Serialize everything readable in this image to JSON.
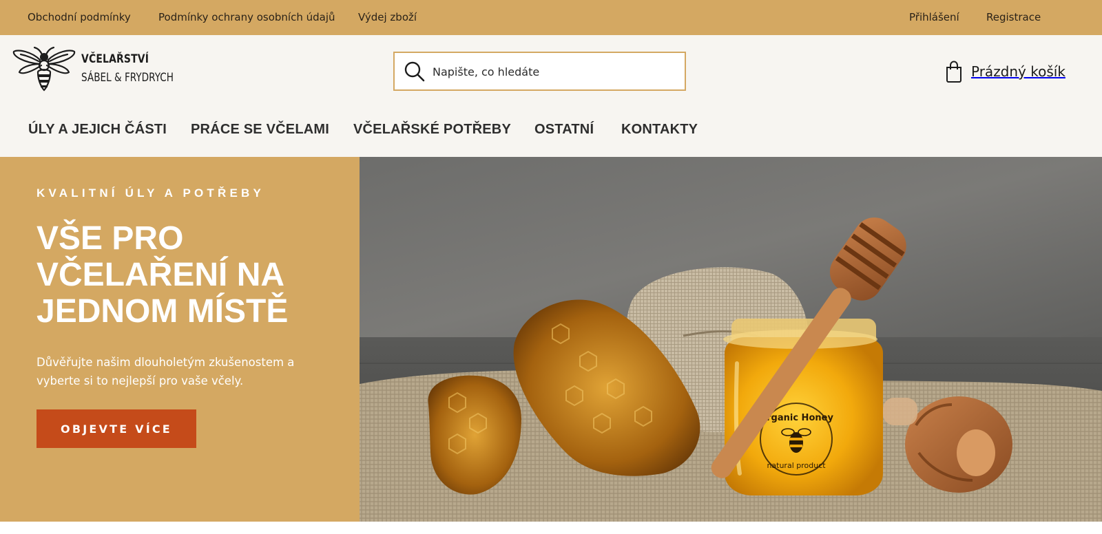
{
  "topbar": {
    "links": [
      "Obchodní podmínky",
      "Podmínky ochrany osobních údajů",
      "Výdej zboží"
    ],
    "account": [
      "Přihlášení",
      "Registrace"
    ]
  },
  "brand": {
    "line1": "VČELAŘSTVÍ",
    "line2": "SÁBEL & FRYDRYCH",
    "icon": "bee-logo-icon"
  },
  "search": {
    "placeholder": "Napište, co hledáte",
    "icon": "search-icon"
  },
  "cart": {
    "label": "Prázdný košík",
    "icon": "shopping-bag-icon"
  },
  "nav": {
    "items": [
      "ÚLY A JEJICH ČÁSTI",
      "PRÁCE SE VČELAMI",
      "VČELAŘSKÉ POTŘEBY",
      "OSTATNÍ",
      "KONTAKTY"
    ]
  },
  "hero": {
    "kicker": "KVALITNÍ ÚLY A POTŘEBY",
    "headline": "VŠE PRO VČELAŘENÍ NA JEDNOM MÍSTĚ",
    "subtext": "Důvěřujte našim dlouholetým zkušenostem a vyberte si to nejlepší pro vaše včely.",
    "cta": "OBJEVTE VÍCE",
    "jar_label_top": "Organic Honey",
    "jar_label_bottom": "natural product"
  },
  "colors": {
    "accent": "#d4a862",
    "cta": "#c54b1a",
    "header_bg": "#f7f5f1"
  }
}
